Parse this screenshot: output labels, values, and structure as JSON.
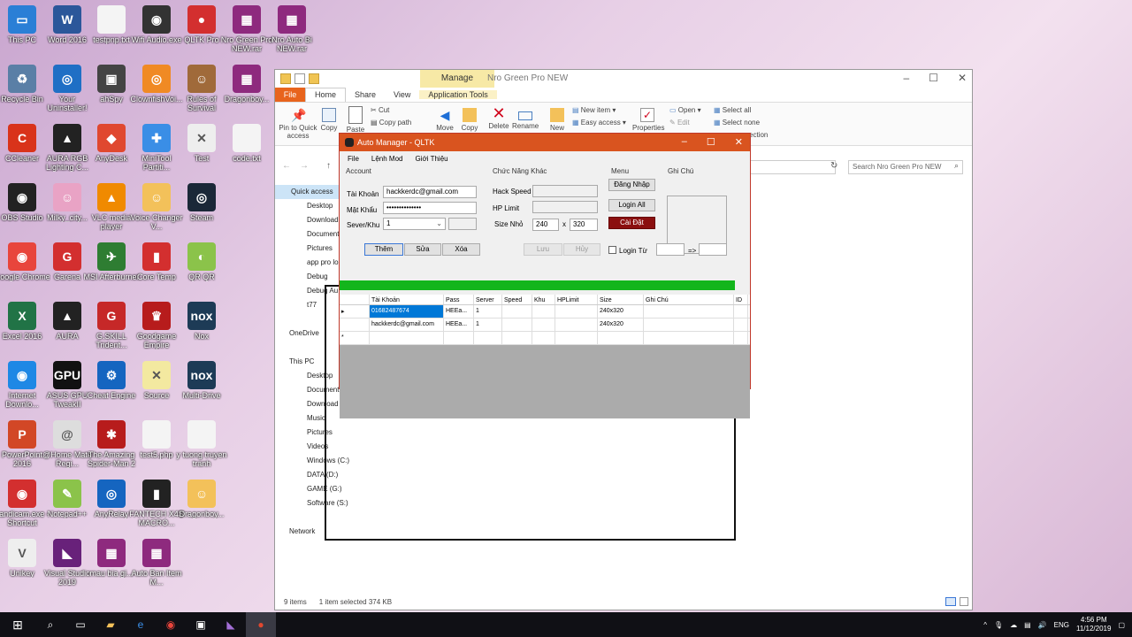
{
  "desktop_icons": [
    {
      "label": "This PC",
      "color": "#2a7fd6",
      "glyph": "▭",
      "icon": "this-pc-icon"
    },
    {
      "label": "Word 2016",
      "color": "#2b579a",
      "glyph": "W",
      "icon": "word-icon"
    },
    {
      "label": "testpnp.txt",
      "color": "#f4f4f4",
      "glyph": "",
      "icon": "text-file-icon"
    },
    {
      "label": "Wifi Audio.exe",
      "color": "#333",
      "glyph": "◉",
      "icon": "speaker-icon"
    },
    {
      "label": "QLTK Pro",
      "color": "#d32f2f",
      "glyph": "●",
      "icon": "gamepad-icon"
    },
    {
      "label": "Nro Green Pro NEW.rar",
      "color": "#8e2a7e",
      "glyph": "▦",
      "icon": "winrar-icon"
    },
    {
      "label": "Nro Auto Bi NEW.rar",
      "color": "#8e2a7e",
      "glyph": "▦",
      "icon": "winrar-icon"
    },
    {
      "label": "Recycle Bin",
      "color": "#5a7fa6",
      "glyph": "♻",
      "icon": "recycle-bin-icon"
    },
    {
      "label": "Your Uninstaller!",
      "color": "#1f6fc5",
      "glyph": "◎",
      "icon": "uninstaller-icon"
    },
    {
      "label": "ahSpy",
      "color": "#444",
      "glyph": "▣",
      "icon": "window-icon"
    },
    {
      "label": "ClownfishVoi...",
      "color": "#f08a24",
      "glyph": "◎",
      "icon": "clownfish-icon"
    },
    {
      "label": "Rules of Survival",
      "color": "#a06a3a",
      "glyph": "☺",
      "icon": "game-icon"
    },
    {
      "label": "Dragonboy...",
      "color": "#8e2a7e",
      "glyph": "▦",
      "icon": "winrar-icon"
    },
    {
      "label": "CCleaner",
      "color": "#d9331a",
      "glyph": "C",
      "icon": "ccleaner-icon"
    },
    {
      "label": "AURA RGB Lighting C...",
      "color": "#222",
      "glyph": "▲",
      "icon": "aura-icon"
    },
    {
      "label": "AnyDesk",
      "color": "#e0482f",
      "glyph": "◆",
      "icon": "anydesk-icon"
    },
    {
      "label": "MiniTool Partiti...",
      "color": "#3a8ee6",
      "glyph": "✚",
      "icon": "minitool-icon"
    },
    {
      "label": "Test",
      "color": "#eee",
      "glyph": "✕",
      "icon": "vs-file-icon"
    },
    {
      "label": "code.txt",
      "color": "#f4f4f4",
      "glyph": "",
      "icon": "text-file-icon"
    },
    {
      "label": "OBS Studio",
      "color": "#222",
      "glyph": "◉",
      "icon": "obs-icon"
    },
    {
      "label": "Milky_city...",
      "color": "#e9a3c5",
      "glyph": "☺",
      "icon": "anime-icon"
    },
    {
      "label": "VLC media player",
      "color": "#f08a00",
      "glyph": "▲",
      "icon": "vlc-icon"
    },
    {
      "label": "Voice Changer V...",
      "color": "#f3c15a",
      "glyph": "☺",
      "icon": "voice-changer-icon"
    },
    {
      "label": "Steam",
      "color": "#1b2838",
      "glyph": "◎",
      "icon": "steam-icon"
    },
    {
      "label": "Google Chrome",
      "color": "#e8453c",
      "glyph": "◉",
      "icon": "chrome-icon"
    },
    {
      "label": "Garena",
      "color": "#d32f2f",
      "glyph": "G",
      "icon": "garena-icon"
    },
    {
      "label": "MSI Afterburner",
      "color": "#2e7d32",
      "glyph": "✈",
      "icon": "msi-icon"
    },
    {
      "label": "Core Temp",
      "color": "#d32f2f",
      "glyph": "▮",
      "icon": "core-temp-icon"
    },
    {
      "label": "QR QR",
      "color": "#8bc34a",
      "glyph": "◐",
      "icon": "qr-icon"
    },
    {
      "label": "Excel 2016",
      "color": "#217346",
      "glyph": "X",
      "icon": "excel-icon"
    },
    {
      "label": "AURA",
      "color": "#222",
      "glyph": "▲",
      "icon": "aura-icon"
    },
    {
      "label": "G.SKILL Trident...",
      "color": "#c62828",
      "glyph": "G",
      "icon": "gskill-icon"
    },
    {
      "label": "Goodgame Empire",
      "color": "#b71c1c",
      "glyph": "♛",
      "icon": "goodgame-icon"
    },
    {
      "label": "Nox",
      "color": "#1d3b56",
      "glyph": "nox",
      "icon": "nox-icon"
    },
    {
      "label": "Internet Downlo...",
      "color": "#1e88e5",
      "glyph": "◉",
      "icon": "idm-icon"
    },
    {
      "label": "ASUS GPU TweakII",
      "color": "#111",
      "glyph": "GPU",
      "icon": "asus-gpu-icon"
    },
    {
      "label": "Cheat Engine",
      "color": "#1565c0",
      "glyph": "⚙",
      "icon": "cheat-engine-icon"
    },
    {
      "label": "Source",
      "color": "#f3e9a0",
      "glyph": "✕",
      "icon": "vs-file-icon"
    },
    {
      "label": "Multi-Drive",
      "color": "#1d3b56",
      "glyph": "nox",
      "icon": "nox-icon"
    },
    {
      "label": "PowerPoint 2016",
      "color": "#d24726",
      "glyph": "P",
      "icon": "powerpoint-icon"
    },
    {
      "label": "@Home Mate Regi...",
      "color": "#ddd",
      "glyph": "@",
      "icon": "at-icon"
    },
    {
      "label": "The Amazing Spider-Man 2",
      "color": "#b71c1c",
      "glyph": "✱",
      "icon": "spiderman-icon"
    },
    {
      "label": "test5.php",
      "color": "#f4f4f4",
      "glyph": "",
      "icon": "text-file-icon"
    },
    {
      "label": "y tuong truyen tranh",
      "color": "#f4f4f4",
      "glyph": "",
      "icon": "text-file-icon"
    },
    {
      "label": "bandicam.exe - Shortcut",
      "color": "#d32f2f",
      "glyph": "◉",
      "icon": "bandicam-icon"
    },
    {
      "label": "Notepad++",
      "color": "#8bc34a",
      "glyph": "✎",
      "icon": "notepad-icon"
    },
    {
      "label": "AnyRelay",
      "color": "#1565c0",
      "glyph": "◎",
      "icon": "anyrelay-icon"
    },
    {
      "label": "FANTECH X4S MACRO...",
      "color": "#222",
      "glyph": "▮",
      "icon": "mouse-icon"
    },
    {
      "label": "Dragonboy...",
      "color": "#f3c15a",
      "glyph": "☺",
      "icon": "game-icon"
    },
    {
      "label": "Unikey",
      "color": "#eee",
      "glyph": "V",
      "icon": "unikey-icon"
    },
    {
      "label": "Visual Studio 2019",
      "color": "#68217a",
      "glyph": "◣",
      "icon": "visual-studio-icon"
    },
    {
      "label": "mau bia gi...",
      "color": "#8e2a7e",
      "glyph": "▦",
      "icon": "winrar-icon"
    },
    {
      "label": "Auto Ban Item M...",
      "color": "#8e2a7e",
      "glyph": "▦",
      "icon": "winrar-icon"
    }
  ],
  "explorer": {
    "manage_label": "Manage",
    "title": "Nro Green Pro NEW",
    "tabs": [
      "File",
      "Home",
      "Share",
      "View",
      "Application Tools"
    ],
    "ribbon": {
      "pin": "Pin to Quick access",
      "copy": "Copy",
      "paste": "Paste",
      "cut": "Cut",
      "copy_path": "Copy path",
      "move": "Move",
      "copy2": "Copy",
      "delete": "Delete",
      "rename": "Rename",
      "new_folder": "New",
      "new_item": "New item ▾",
      "easy_access": "Easy access ▾",
      "properties": "Properties",
      "open": "Open ▾",
      "edit": "Edit",
      "select_all": "Select all",
      "select_none": "Select none",
      "ection": "ection"
    },
    "search_placeholder": "Search Nro Green Pro NEW",
    "nav": [
      "Quick access",
      "Desktop",
      "Download",
      "Document",
      "Pictures",
      "app pro lo",
      "Debug",
      "Debug Au",
      "t77",
      "",
      "OneDrive",
      "",
      "This PC",
      "Desktop",
      "Document",
      "Download",
      "Music",
      "Pictures",
      "Videos",
      "Windows (C:)",
      "DATA (D:)",
      "GAME (G:)",
      "Software (S:)",
      "",
      "Network"
    ],
    "status_items": "9 items",
    "status_selected": "1 item selected  374 KB"
  },
  "app": {
    "title": "Auto Manager - QLTK",
    "menu": [
      "File",
      "Lệnh Mod",
      "Giới Thiệu"
    ],
    "account_group": "Account",
    "tai_khoan_label": "Tài Khoản",
    "tai_khoan_value": "hackkerdc@gmail.com",
    "mat_khau_label": "Mật Khẩu",
    "mat_khau_value": "••••••••••••••",
    "sever_label": "Sever/Khu",
    "sever_value": "1",
    "chuc_nang_group": "Chức Năng Khác",
    "hack_speed_label": "Hack Speed",
    "hp_limit_label": "HP Limit",
    "size_nho_label": "Size Nhỏ",
    "size_w": "240",
    "size_x": "x",
    "size_h": "320",
    "menu_group": "Menu",
    "dang_nhap": "Đăng Nhập",
    "login_all": "Login All",
    "cai_dat": "Cài Đặt",
    "ghi_chu_group": "Ghi Chú",
    "them": "Thêm",
    "sua": "Sửa",
    "xoa": "Xóa",
    "luu": "Lưu",
    "huy": "Hủy",
    "login_tu": "Login Từ",
    "arrow": "=>",
    "progress": 1.0,
    "columns": [
      "",
      "Tài Khoản",
      "Pass",
      "Server",
      "Speed",
      "Khu",
      "HPLimit",
      "Size",
      "Ghi Chú",
      "ID"
    ],
    "rows": [
      {
        "marker": "▸",
        "account": "01682487674",
        "pass": "HEEa...",
        "server": "1",
        "speed": "",
        "khu": "",
        "hp": "",
        "size": "240x320",
        "note": "",
        "id": ""
      },
      {
        "marker": "",
        "account": "hackkerdc@gmail.com",
        "pass": "HEEa...",
        "server": "1",
        "speed": "",
        "khu": "",
        "hp": "",
        "size": "240x320",
        "note": "",
        "id": ""
      },
      {
        "marker": "*",
        "account": "",
        "pass": "",
        "server": "",
        "speed": "",
        "khu": "",
        "hp": "",
        "size": "",
        "note": "",
        "id": ""
      }
    ]
  },
  "taskbar": {
    "lang": "ENG",
    "time": "4:56 PM",
    "date": "11/12/2019"
  }
}
